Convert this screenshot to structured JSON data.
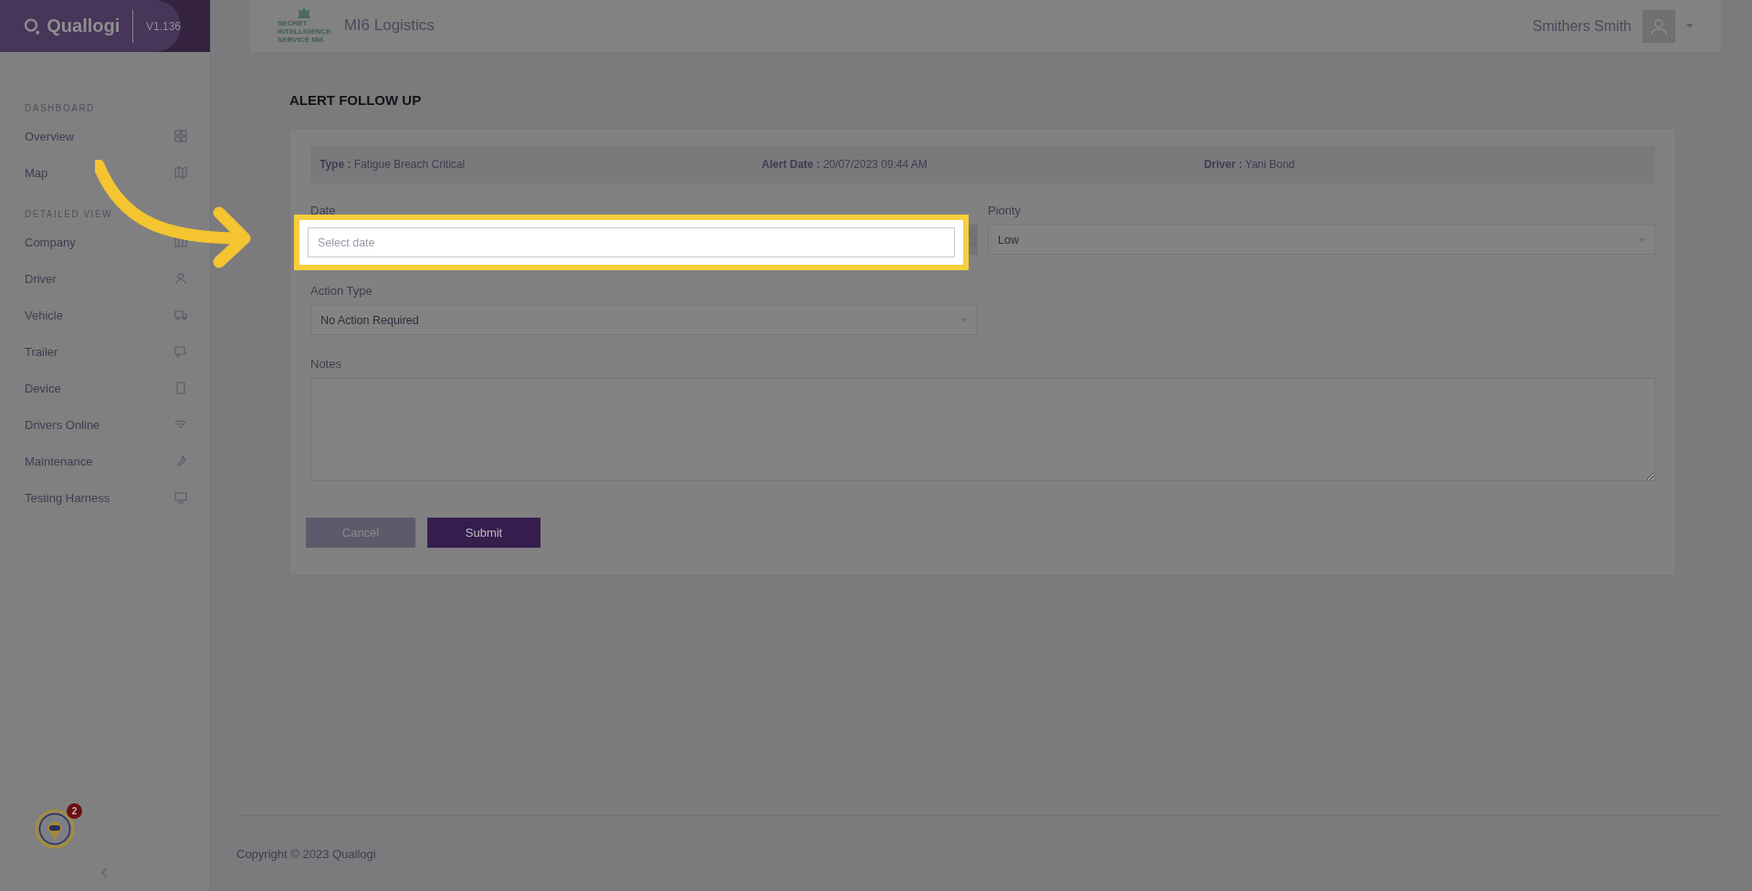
{
  "brand": {
    "name": "Quallogi",
    "version": "V1.136"
  },
  "sidebar": {
    "sections": [
      {
        "heading": "DASHBOARD",
        "items": [
          {
            "label": "Overview"
          },
          {
            "label": "Map"
          }
        ]
      },
      {
        "heading": "DETAILED VIEW",
        "items": [
          {
            "label": "Company"
          },
          {
            "label": "Driver"
          },
          {
            "label": "Vehicle"
          },
          {
            "label": "Trailer"
          },
          {
            "label": "Device"
          },
          {
            "label": "Drivers Online"
          },
          {
            "label": "Maintenance"
          },
          {
            "label": "Testing Harness"
          }
        ]
      }
    ],
    "assistant_badge": "2"
  },
  "header": {
    "logo_lines": [
      "SECRET",
      "INTELLIGENCE",
      "SERVICE MI6"
    ],
    "company": "MI6 Logistics",
    "user": "Smithers Smith"
  },
  "page_title": "ALERT FOLLOW UP",
  "info": [
    {
      "label": "Type :",
      "value": "Fatigue Breach Critical"
    },
    {
      "label": "Alert Date :",
      "value": "20/07/2023 09:44 AM"
    },
    {
      "label": "Driver :",
      "value": "Yani Bond"
    }
  ],
  "form": {
    "date": {
      "label": "Date",
      "placeholder": "Select date",
      "highlighted": true
    },
    "priority": {
      "label": "Piority",
      "value": "Low"
    },
    "action_type": {
      "label": "Action Type",
      "value": "No Action Required"
    },
    "notes": {
      "label": "Notes"
    },
    "buttons": [
      {
        "label": "Cancel",
        "kind": "secondary"
      },
      {
        "label": "Submit",
        "kind": "primary"
      }
    ]
  },
  "footer": "Copyright © 2023 Quallogi"
}
